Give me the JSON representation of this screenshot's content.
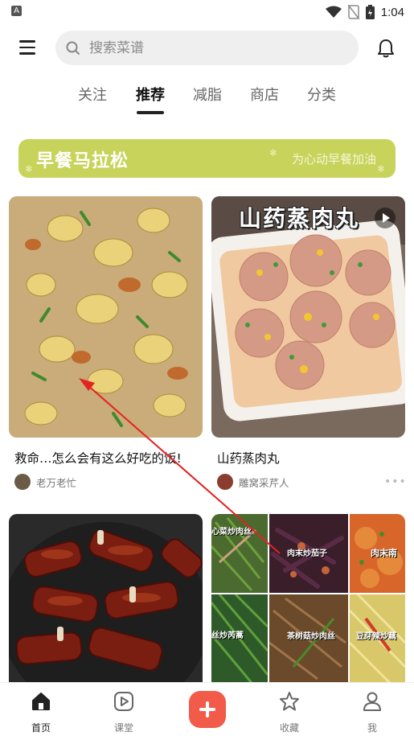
{
  "status_bar": {
    "time": "1:04",
    "app_badge": "A"
  },
  "header": {
    "search_placeholder": "搜索菜谱"
  },
  "tabs": [
    {
      "label": "关注",
      "active": false
    },
    {
      "label": "推荐",
      "active": true
    },
    {
      "label": "减脂",
      "active": false
    },
    {
      "label": "商店",
      "active": false
    },
    {
      "label": "分类",
      "active": false
    }
  ],
  "banner": {
    "title": "早餐马拉松",
    "subtitle": "为心动早餐加油",
    "color": "#c7d35a"
  },
  "cards": [
    {
      "title": "救命…怎么会有这么好吃的饭!",
      "author": "老万老忙",
      "has_video": false
    },
    {
      "title": "山药蒸肉丸",
      "image_text": "山药蒸肉丸",
      "author": "雕窝采芹人",
      "has_video": true
    },
    {
      "title": "",
      "author": "",
      "has_video": false
    },
    {
      "title": "",
      "author": "",
      "has_video": false,
      "grid_labels": [
        "心菜炒肉丝",
        "肉末炒茄子",
        "肉末南",
        "丝炒芮蒿",
        "茶树菇炒肉丝",
        "豆芽辣炒藕"
      ]
    }
  ],
  "bottom_nav": [
    {
      "label": "首页",
      "icon": "home-icon",
      "active": true
    },
    {
      "label": "课堂",
      "icon": "play-square-icon",
      "active": false
    },
    {
      "label": "",
      "icon": "add-icon",
      "active": false
    },
    {
      "label": "收藏",
      "icon": "star-icon",
      "active": false
    },
    {
      "label": "我",
      "icon": "person-icon",
      "active": false
    }
  ],
  "colors": {
    "accent": "#f25a4a",
    "active_text": "#111111",
    "inactive_text": "#666666"
  }
}
